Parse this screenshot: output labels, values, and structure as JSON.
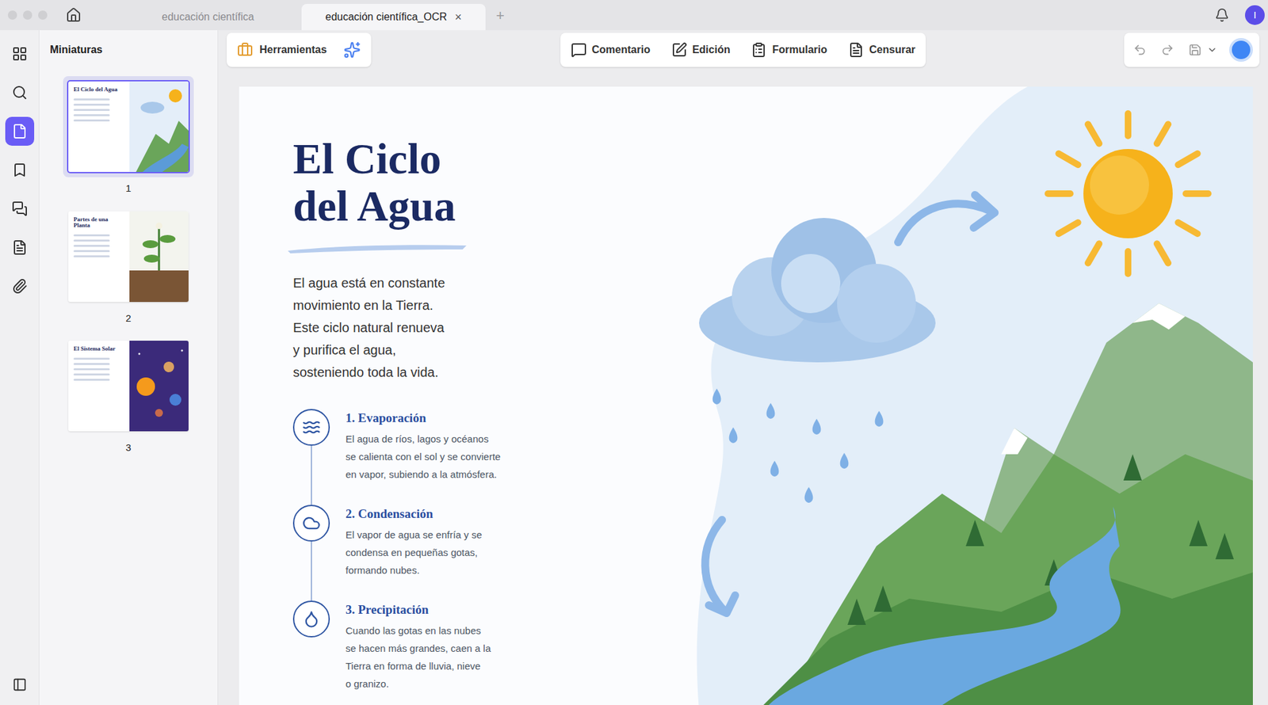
{
  "window": {
    "tabs": [
      {
        "label": "educación científica",
        "selected": false
      },
      {
        "label": "educación científica_OCR",
        "selected": true,
        "close": "×"
      }
    ],
    "new_tab": "+",
    "avatar": "I"
  },
  "rail": [
    {
      "selected": false
    },
    {
      "selected": false
    },
    {
      "selected": true
    },
    {
      "selected": false
    },
    {
      "selected": false
    },
    {
      "selected": false
    },
    {
      "selected": false
    }
  ],
  "sidebar": {
    "title": "Miniaturas",
    "thumbnails": [
      {
        "page": "1",
        "title": "El Ciclo del Agua",
        "kind": "water",
        "selected": true
      },
      {
        "page": "2",
        "title": "Partes de una Planta",
        "kind": "plant",
        "selected": false
      },
      {
        "page": "3",
        "title": "El Sistema Solar",
        "kind": "space",
        "selected": false
      }
    ]
  },
  "toolbar": {
    "tools": "Herramientas",
    "modes": [
      "Comentario",
      "Edición",
      "Formulario",
      "Censurar"
    ]
  },
  "document": {
    "title_lines": [
      "El Ciclo",
      "del Agua"
    ],
    "intro_lines": [
      "El agua está en constante",
      "movimiento en la Tierra.",
      "Este ciclo natural renueva",
      "y purifica el agua,",
      "sosteniendo toda la vida."
    ],
    "steps": [
      {
        "title": "1. Evaporación",
        "lines": [
          "El agua de ríos, lagos y océanos",
          "se calienta con el sol y se convierte",
          "en vapor, subiendo a la atmósfera."
        ]
      },
      {
        "title": "2. Condensación",
        "lines": [
          "El vapor de agua se enfría y se",
          "condensa en pequeñas gotas,",
          "formando nubes."
        ]
      },
      {
        "title": "3. Precipitación",
        "lines": [
          "Cuando las gotas en las nubes",
          "se hacen más grandes, caen a la",
          "Tierra en forma de lluvia, nieve",
          "o granizo."
        ]
      }
    ]
  }
}
